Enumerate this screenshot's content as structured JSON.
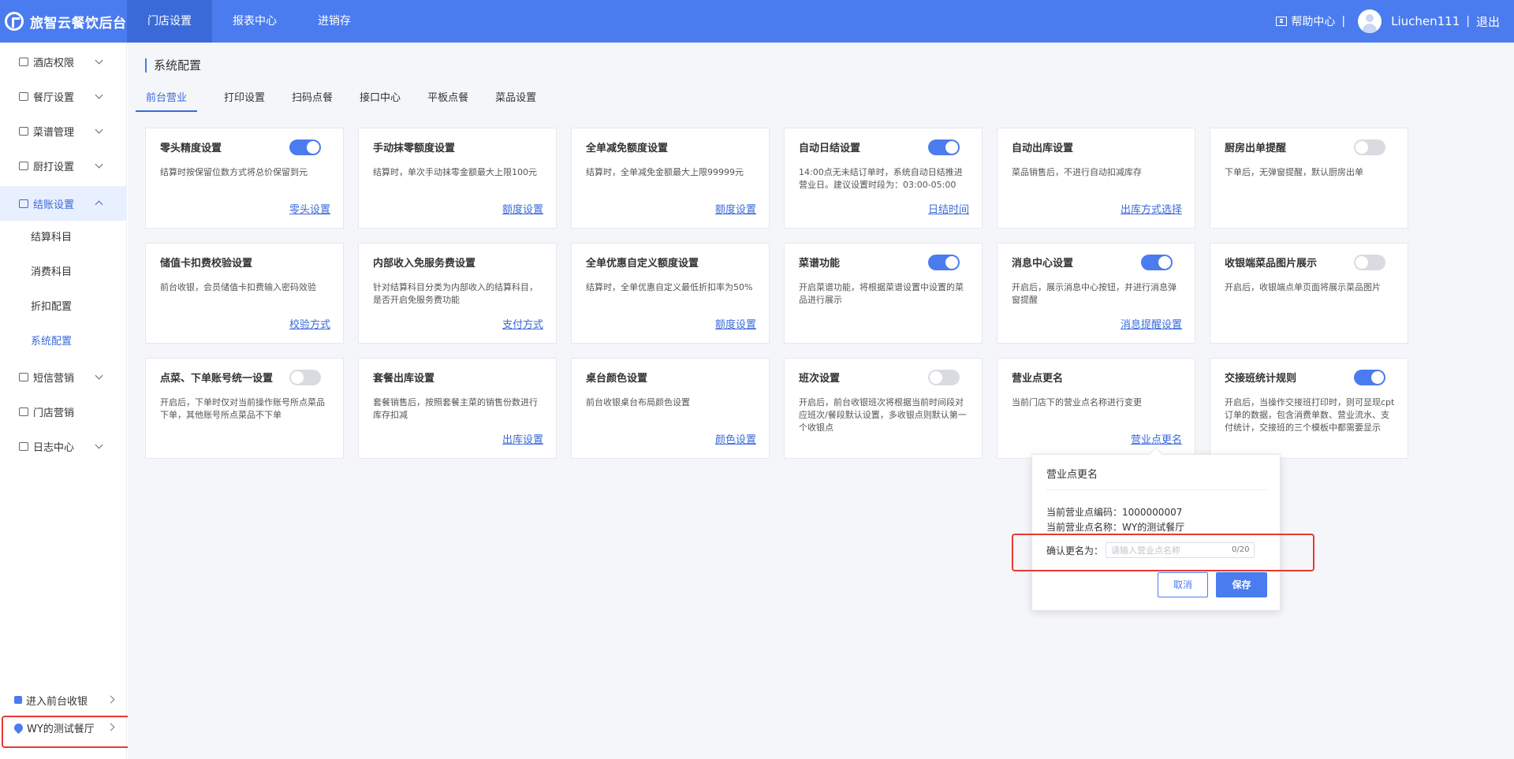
{
  "app": {
    "logo_text": "旅智云餐饮后台"
  },
  "top_nav": [
    {
      "label": "门店设置",
      "active": true
    },
    {
      "label": "报表中心",
      "active": false
    },
    {
      "label": "进销存",
      "active": false
    }
  ],
  "header_right": {
    "help": "帮助中心",
    "separator": "|",
    "username": "Liuchen111",
    "separator2": "|",
    "logout": "退出"
  },
  "sidebar": {
    "items": [
      {
        "label": "酒店权限"
      },
      {
        "label": "餐厅设置"
      },
      {
        "label": "菜谱管理"
      },
      {
        "label": "厨打设置"
      },
      {
        "label": "结账设置",
        "expanded": true
      },
      {
        "label": "短信营销"
      },
      {
        "label": "门店营销"
      },
      {
        "label": "日志中心"
      }
    ],
    "sub_items": [
      {
        "label": "结算科目"
      },
      {
        "label": "消费科目"
      },
      {
        "label": "折扣配置"
      },
      {
        "label": "系统配置",
        "active": true
      }
    ],
    "bottom": {
      "front_desk": "进入前台收银",
      "restaurant": "WY的测试餐厅"
    }
  },
  "page": {
    "title": "系统配置",
    "tabs": [
      {
        "label": "前台营业",
        "active": true
      },
      {
        "label": "打印设置"
      },
      {
        "label": "扫码点餐"
      },
      {
        "label": "接口中心"
      },
      {
        "label": "平板点餐"
      },
      {
        "label": "菜品设置"
      }
    ]
  },
  "cards": [
    {
      "title": "零头精度设置",
      "desc": "结算时按保留位数方式将总价保留到元",
      "link": "零头设置",
      "toggle": "on"
    },
    {
      "title": "手动抹零额度设置",
      "desc": "结算时，单次手动抹零金额最大上限100元",
      "link": "额度设置",
      "toggle": "none"
    },
    {
      "title": "全单减免额度设置",
      "desc": "结算时，全单减免金额最大上限99999元",
      "link": "额度设置",
      "toggle": "none"
    },
    {
      "title": "自动日结设置",
      "desc": "14:00点无未结订单时，系统自动日结推进营业日。建议设置时段为：03:00-05:00",
      "link": "日结时间",
      "toggle": "on"
    },
    {
      "title": "自动出库设置",
      "desc": "菜品销售后，不进行自动扣减库存",
      "link": "出库方式选择",
      "toggle": "none"
    },
    {
      "title": "厨房出单提醒",
      "desc": "下单后，无弹窗提醒，默认厨房出单",
      "link": "",
      "toggle": "off"
    },
    {
      "title": "储值卡扣费校验设置",
      "desc": "前台收银，会员储值卡扣费输入密码效验",
      "link": "校验方式",
      "toggle": "none"
    },
    {
      "title": "内部收入免服务费设置",
      "desc": "针对结算科目分类为内部收入的结算科目，是否开启免服务费功能",
      "link": "支付方式",
      "toggle": "none"
    },
    {
      "title": "全单优惠自定义额度设置",
      "desc": "结算时，全单优惠自定义最低折扣率为50%",
      "link": "额度设置",
      "toggle": "none"
    },
    {
      "title": "菜谱功能",
      "desc": "开启菜谱功能，将根据菜谱设置中设置的菜品进行展示",
      "link": "",
      "toggle": "on"
    },
    {
      "title": "消息中心设置",
      "desc": "开启后，展示消息中心按钮，并进行消息弹窗提醒",
      "link": "消息提醒设置",
      "toggle": "on"
    },
    {
      "title": "收银端菜品图片展示",
      "desc": "开启后，收银端点单页面将展示菜品图片",
      "link": "",
      "toggle": "off"
    },
    {
      "title": "点菜、下单账号统一设置",
      "desc": "开启后，下单时仅对当前操作账号所点菜品下单，其他账号所点菜品不下单",
      "link": "",
      "toggle": "off"
    },
    {
      "title": "套餐出库设置",
      "desc": "套餐销售后，按照套餐主菜的销售份数进行库存扣减",
      "link": "出库设置",
      "toggle": "none"
    },
    {
      "title": "桌台颜色设置",
      "desc": "前台收银桌台布局颜色设置",
      "link": "颜色设置",
      "toggle": "none"
    },
    {
      "title": "班次设置",
      "desc": "开启后，前台收银班次将根据当前时间段对应班次/餐段默认设置，多收银点则默认第一个收银点",
      "link": "",
      "toggle": "off"
    },
    {
      "title": "营业点更名",
      "desc": "当前门店下的营业点名称进行变更",
      "link": "营业点更名",
      "toggle": "none"
    },
    {
      "title": "交接班统计规则",
      "desc": "开启后，当操作交接班打印时，则可显现cpt订单的数据，包含消费单数、营业流水、支付统计，交接班的三个模板中都需要显示",
      "link": "",
      "toggle": "on"
    }
  ],
  "popover": {
    "title": "营业点更名",
    "code_line": "当前营业点编码：1000000007",
    "name_line": "当前营业点名称：WY的测试餐厅",
    "confirm_label": "确认更名为：",
    "input_placeholder": "请输入营业点名称",
    "input_value": "",
    "count": "0/20",
    "cancel": "取消",
    "save": "保存"
  },
  "colors": {
    "primary": "#4a7cef",
    "highlight": "#e53935"
  }
}
